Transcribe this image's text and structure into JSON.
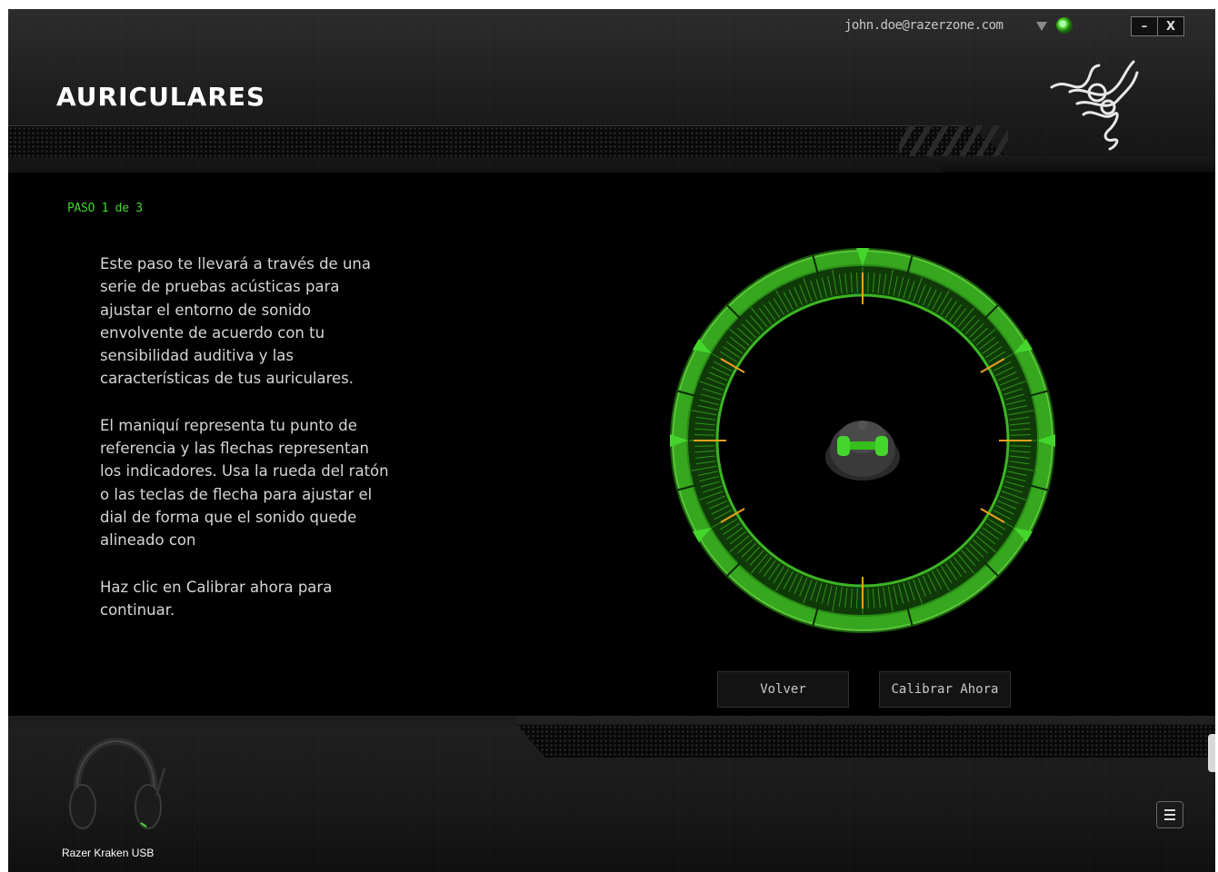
{
  "header": {
    "title": "AURICULARES",
    "user_email": "john.doe@razerzone.com",
    "minimize_label": "–",
    "close_label": "X"
  },
  "wizard": {
    "step_label": "PASO 1 de 3",
    "paragraphs": [
      "Este paso te llevará a través de una serie de pruebas acústicas para ajustar el entorno de sonido envolvente de acuerdo con tu sensibilidad auditiva y las características de tus auriculares.",
      "El maniquí representa tu punto de referencia y las flechas representan los indicadores. Usa la rueda del ratón o las teclas de flecha para ajustar el dial de forma que el sonido quede alineado con",
      "Haz clic en Calibrar ahora para continuar."
    ],
    "back_label": "Volver",
    "calibrate_label": "Calibrar Ahora"
  },
  "footer": {
    "device_name": "Razer Kraken USB"
  },
  "colors": {
    "accent_green": "#44d62c",
    "marker_orange": "#f0a020",
    "background": "#000000"
  },
  "icons": [
    "dropdown-arrow-icon",
    "status-icon",
    "razer-logo-icon",
    "listener-head-icon",
    "headset-icon",
    "menu-icon"
  ]
}
